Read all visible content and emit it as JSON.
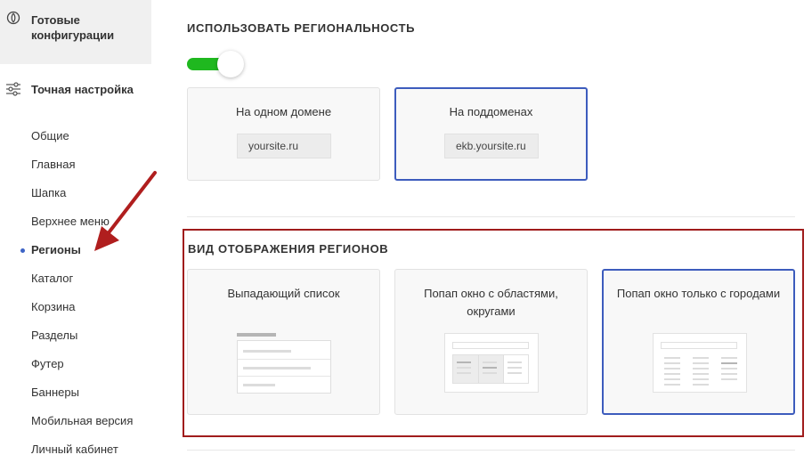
{
  "sidebar": {
    "ready_configs": "Готовые конфигурации",
    "fine_tuning": "Точная настройка",
    "items": [
      {
        "label": "Общие",
        "active": false
      },
      {
        "label": "Главная",
        "active": false
      },
      {
        "label": "Шапка",
        "active": false
      },
      {
        "label": "Верхнее меню",
        "active": false
      },
      {
        "label": "Регионы",
        "active": true
      },
      {
        "label": "Каталог",
        "active": false
      },
      {
        "label": "Корзина",
        "active": false
      },
      {
        "label": "Разделы",
        "active": false
      },
      {
        "label": "Футер",
        "active": false
      },
      {
        "label": "Баннеры",
        "active": false
      },
      {
        "label": "Мобильная версия",
        "active": false
      },
      {
        "label": "Личный кабинет",
        "active": false
      }
    ]
  },
  "regionality": {
    "title": "ИСПОЛЬЗОВАТЬ РЕГИОНАЛЬНОСТЬ",
    "enabled": true,
    "options": [
      {
        "label": "На одном домене",
        "domain": "yoursite.ru",
        "selected": false
      },
      {
        "label": "На поддоменах",
        "domain": "ekb.yoursite.ru",
        "selected": true
      }
    ]
  },
  "display": {
    "title": "ВИД ОТОБРАЖЕНИЯ РЕГИОНОВ",
    "options": [
      {
        "label": "Выпадающий список",
        "selected": false
      },
      {
        "label": "Попап окно с областями, округами",
        "selected": false
      },
      {
        "label": "Попап окно только с городами",
        "selected": true
      }
    ]
  },
  "colors": {
    "toggle_on": "#1fb81f",
    "selected_border": "#3d5cbd",
    "active_dot": "#3d64c6",
    "highlight": "#a01c1c",
    "arrow": "#b01e1e"
  }
}
